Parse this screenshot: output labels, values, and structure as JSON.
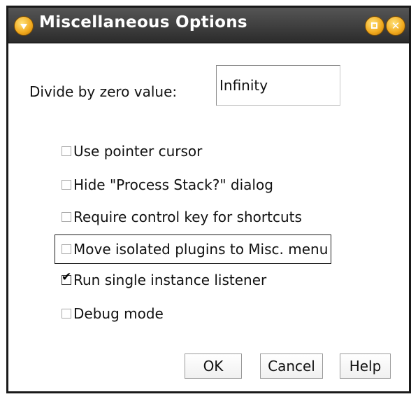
{
  "window": {
    "title": "Miscellaneous Options"
  },
  "form": {
    "divide_by_zero_label": "Divide by zero value:",
    "divide_by_zero_value": "Infinity"
  },
  "checkboxes": [
    {
      "label": "Use pointer cursor",
      "checked": false
    },
    {
      "label": "Hide \"Process Stack?\" dialog",
      "checked": false
    },
    {
      "label": "Require control key for shortcuts",
      "checked": false
    },
    {
      "label": "Move isolated plugins to Misc. menu",
      "checked": false,
      "focused": true
    },
    {
      "label": "Run single instance listener",
      "checked": true
    },
    {
      "label": "Debug mode",
      "checked": false
    }
  ],
  "buttons": {
    "ok": "OK",
    "cancel": "Cancel",
    "help": "Help"
  },
  "icons": {
    "window_menu": "window-menu-icon",
    "maximize": "maximize-icon",
    "close": "close-icon",
    "check": "checkmark-icon"
  },
  "colors": {
    "titlebar": "#2b2b2b",
    "title_text": "#ffffff",
    "window_buttons": "#f0a81c",
    "border": "#1a1a1a"
  }
}
